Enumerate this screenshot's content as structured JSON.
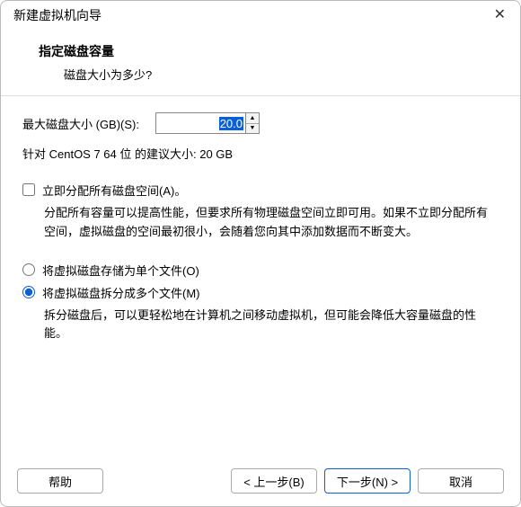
{
  "window": {
    "title": "新建虚拟机向导"
  },
  "header": {
    "title": "指定磁盘容量",
    "subtitle": "磁盘大小为多少?"
  },
  "disk": {
    "label": "最大磁盘大小 (GB)(S):",
    "value": "20.0",
    "hint": "针对 CentOS 7 64 位 的建议大小: 20 GB"
  },
  "allocate": {
    "label": "立即分配所有磁盘空间(A)。",
    "desc": "分配所有容量可以提高性能，但要求所有物理磁盘空间立即可用。如果不立即分配所有空间，虚拟磁盘的空间最初很小，会随着您向其中添加数据而不断变大。"
  },
  "storage": {
    "single_label": "将虚拟磁盘存储为单个文件(O)",
    "split_label": "将虚拟磁盘拆分成多个文件(M)",
    "split_desc": "拆分磁盘后，可以更轻松地在计算机之间移动虚拟机，但可能会降低大容量磁盘的性能。"
  },
  "footer": {
    "help": "帮助",
    "back": "< 上一步(B)",
    "next": "下一步(N) >",
    "cancel": "取消"
  }
}
